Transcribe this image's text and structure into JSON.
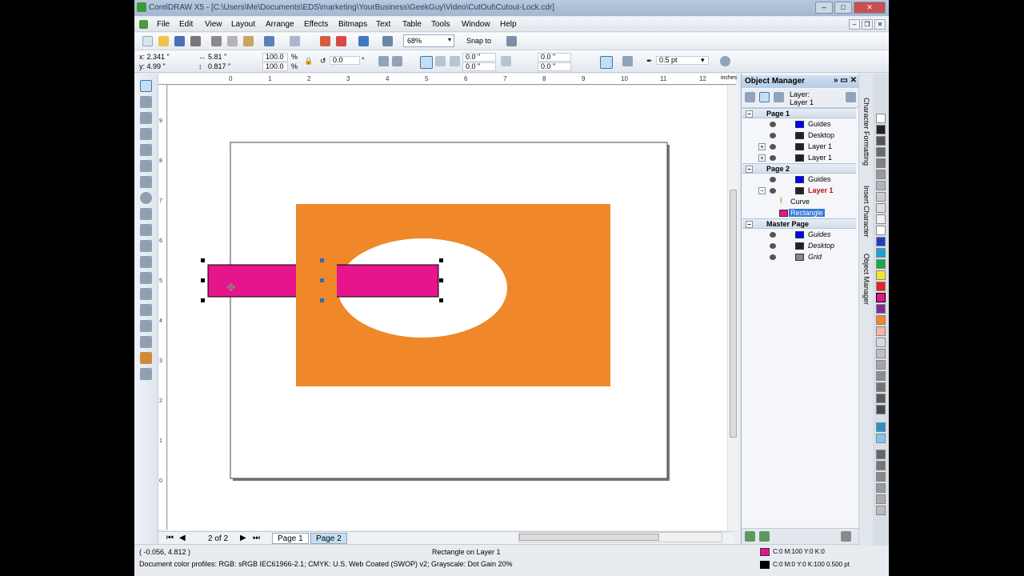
{
  "window": {
    "title": "CorelDRAW X5 - [C:\\Users\\Me\\Documents\\EDS\\marketing\\YourBusiness\\GeekGuy\\Video\\CutOut\\Cutout-Lock.cdr]"
  },
  "menu": {
    "items": [
      "File",
      "Edit",
      "View",
      "Layout",
      "Arrange",
      "Effects",
      "Bitmaps",
      "Text",
      "Table",
      "Tools",
      "Window",
      "Help"
    ]
  },
  "toolbar": {
    "zoom": "68%",
    "snap_label": "Snap to"
  },
  "property_bar": {
    "x": "x: 2.341 \"",
    "y": "y: 4.99 \"",
    "width": "5.81 \"",
    "height": "0.817 \"",
    "scale_w": "100.0",
    "scale_h": "100.0",
    "pct": "%",
    "rotation": "0.0",
    "deg": "°",
    "corner1": "0.0 \"",
    "corner2": "0.0 \"",
    "corner3": "0.0 \"",
    "corner4": "0.0 \"",
    "outline_width": "0.5 pt"
  },
  "ruler": {
    "units": "inches",
    "h_ticks": [
      "0",
      "1",
      "2",
      "3",
      "4",
      "5",
      "6",
      "7",
      "8",
      "9",
      "10",
      "11",
      "12"
    ],
    "v_ticks": [
      "9",
      "8",
      "7",
      "6",
      "5",
      "4",
      "3",
      "2",
      "1",
      "0"
    ]
  },
  "pages": {
    "count": "2 of 2",
    "tabs": [
      "Page 1",
      "Page 2"
    ],
    "active": "Page 2"
  },
  "status": {
    "coords": "( -0.056, 4.812 )",
    "object_info": "Rectangle on Layer 1",
    "profiles": "Document color profiles: RGB: sRGB IEC61966-2.1; CMYK: U.S. Web Coated (SWOP) v2; Grayscale: Dot Gain 20%",
    "fill": "C:0 M:100 Y:0 K:0",
    "stroke": "C:0 M:0 Y:0 K:100  0.500 pt"
  },
  "object_manager": {
    "title": "Object Manager",
    "layer_label": "Layer:",
    "layer_value": "Layer 1",
    "tree": [
      {
        "label": "Page 1",
        "kind": "page"
      },
      {
        "label": "Guides",
        "kind": "layer",
        "color": "#0000ff"
      },
      {
        "label": "Desktop",
        "kind": "layer",
        "color": "#222222"
      },
      {
        "label": "Layer 1",
        "kind": "layer",
        "color": "#222222"
      },
      {
        "label": "Layer 1",
        "kind": "layer",
        "color": "#222222"
      },
      {
        "label": "Page 2",
        "kind": "page"
      },
      {
        "label": "Guides",
        "kind": "layer",
        "color": "#0000ff"
      },
      {
        "label": "Layer 1",
        "kind": "layer-active",
        "color": "#222222"
      },
      {
        "label": "Curve",
        "kind": "object"
      },
      {
        "label": "Rectangle",
        "kind": "object-selected",
        "color": "#e6158c"
      },
      {
        "label": "Master Page",
        "kind": "page"
      },
      {
        "label": "Guides",
        "kind": "layer",
        "color": "#0000ff"
      },
      {
        "label": "Desktop",
        "kind": "layer",
        "color": "#222222"
      },
      {
        "label": "Grid",
        "kind": "layer",
        "color": "#888888"
      }
    ]
  },
  "side_tabs": [
    "Character Formatting",
    "Insert Character",
    "Object Manager"
  ],
  "colors": {
    "orange": "#f0882a",
    "magenta": "#e6158c",
    "accent": "#c4dff4"
  }
}
